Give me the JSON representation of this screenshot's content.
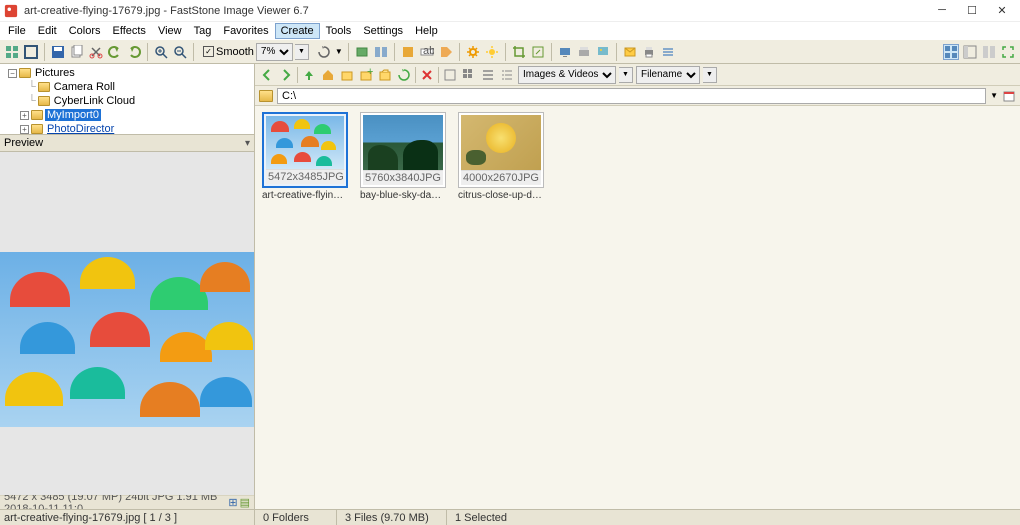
{
  "title": "art-creative-flying-17679.jpg  -  FastStone Image Viewer 6.7",
  "menu": [
    "File",
    "Edit",
    "Colors",
    "Effects",
    "View",
    "Tag",
    "Favorites",
    "Create",
    "Tools",
    "Settings",
    "Help"
  ],
  "menu_active": "Create",
  "smooth_label": "Smooth",
  "smooth_value": "7%",
  "tree": {
    "root": "Pictures",
    "items": [
      "Camera Roll",
      "CyberLink Cloud",
      "MyImport0",
      "PhotoDirector"
    ],
    "selected": "MyImport0"
  },
  "preview_label": "Preview",
  "address": "C:\\",
  "filter1": "Images & Videos",
  "filter2": "Filename",
  "thumbs": [
    {
      "dim": "5472x3485",
      "ext": "JPG",
      "name": "art-creative-flying-1...",
      "sel": true,
      "bg": "linear-gradient(#7ab8e8,#cfe7f7)"
    },
    {
      "dim": "5760x3840",
      "ext": "JPG",
      "name": "bay-blue-sky-daylig...",
      "sel": false,
      "bg": "linear-gradient(#2a6ea8,#3a8acb)"
    },
    {
      "dim": "4000x2670",
      "ext": "JPG",
      "name": "citrus-close-up-delic...",
      "sel": false,
      "bg": "linear-gradient(#d8c47a,#c2a85e)"
    }
  ],
  "status_left": "5472 x 3485 (19.07 MP)  24bit  JPG  1.91 MB  2018-10-11 11:0",
  "status_line2": "art-creative-flying-17679.jpg [ 1 / 3 ]",
  "status_folders": "0 Folders",
  "status_files": "3 Files (9.70 MB)",
  "status_selected": "1 Selected"
}
